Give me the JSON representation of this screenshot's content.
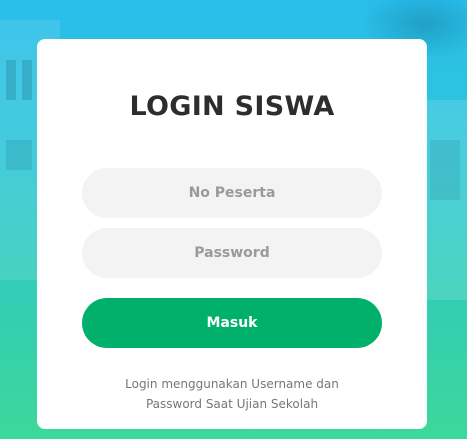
{
  "login": {
    "title": "LOGIN SISWA",
    "username_placeholder": "No Peserta",
    "password_placeholder": "Password",
    "submit_label": "Masuk",
    "note_line1": "Login menggunakan Username dan",
    "note_line2": "Password Saat Ujian Sekolah"
  },
  "colors": {
    "background_top": "#29bdeb",
    "background_bottom": "#3dd89a",
    "card": "#ffffff",
    "button": "#00b06b",
    "field": "#f3f3f3"
  }
}
